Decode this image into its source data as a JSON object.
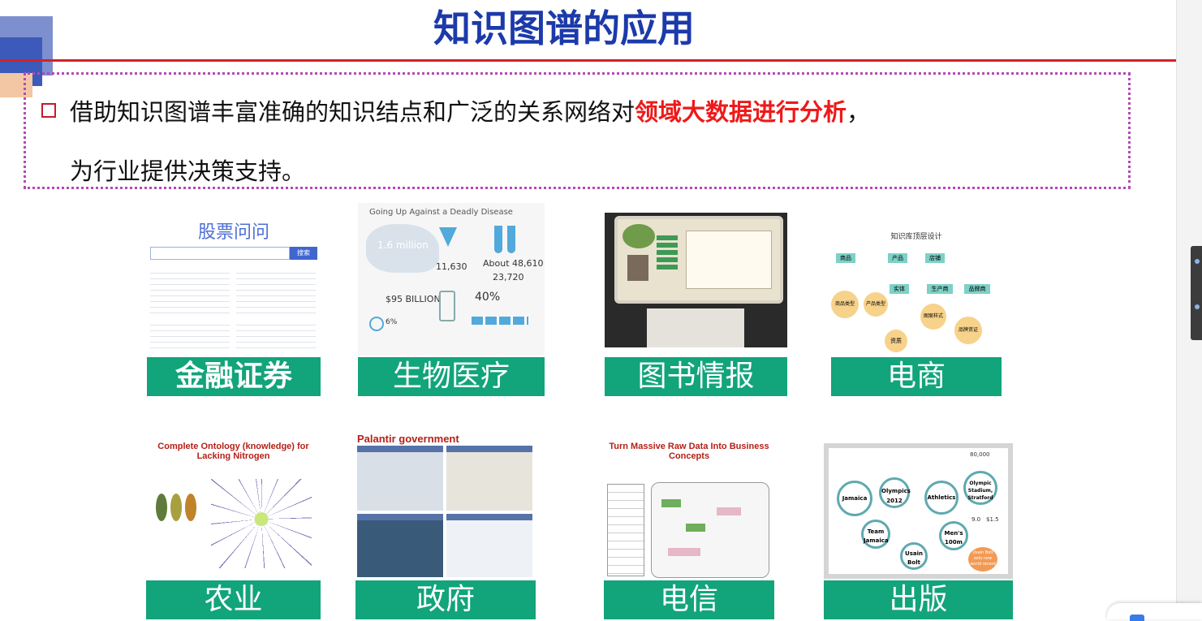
{
  "slide": {
    "title": "知识图谱的应用",
    "bullet_line1_prefix": "借助知识图谱丰富准确的知识结点和广泛的关系网络对",
    "bullet_highlight": "领域大数据进行分析",
    "bullet_line1_suffix": "，",
    "bullet_line2": "为行业提供决策支持。"
  },
  "tiles": [
    {
      "label": "金融证券",
      "pic_title": "股票问问",
      "pic_button": "搜索"
    },
    {
      "label": "生物医疗",
      "pic_title": "Going Up Against a Deadly Disease",
      "stats": [
        "1.6 million",
        "11,630",
        "About 48,610",
        "23,720",
        "$95 BILLION",
        "40%",
        "6%"
      ]
    },
    {
      "label": "图书情报",
      "pic_title": ""
    },
    {
      "label": "电商",
      "pic_title": "知识库顶层设计",
      "nodes": [
        "商品",
        "产品",
        "品牌",
        "店铺",
        "实体",
        "生产商",
        "品牌商",
        "商品类型",
        "产品类型",
        "图案样式",
        "资质",
        "品牌资证"
      ]
    },
    {
      "label": "农业",
      "pic_title": "Complete Ontology (knowledge) for Lacking Nitrogen"
    },
    {
      "label": "政府",
      "pic_title": "Palantir government"
    },
    {
      "label": "电信",
      "pic_title": "Turn Massive Raw Data Into Business Concepts"
    },
    {
      "label": "出版",
      "nodes": [
        "Jamaica",
        "Olympics 2012",
        "Athletics",
        "Olympic Stadium, Stratford",
        "Team Jamaica",
        "Men's 100m",
        "Usain Bolt",
        "Usain Bolt sets new world record",
        "80,000",
        "9.0",
        "$1.5"
      ]
    }
  ],
  "colors": {
    "title": "#1c3aa9",
    "rule": "#d71f26",
    "highlight": "#ee1919",
    "label_bg": "#12a47b",
    "dotted": "#b24ab5"
  }
}
